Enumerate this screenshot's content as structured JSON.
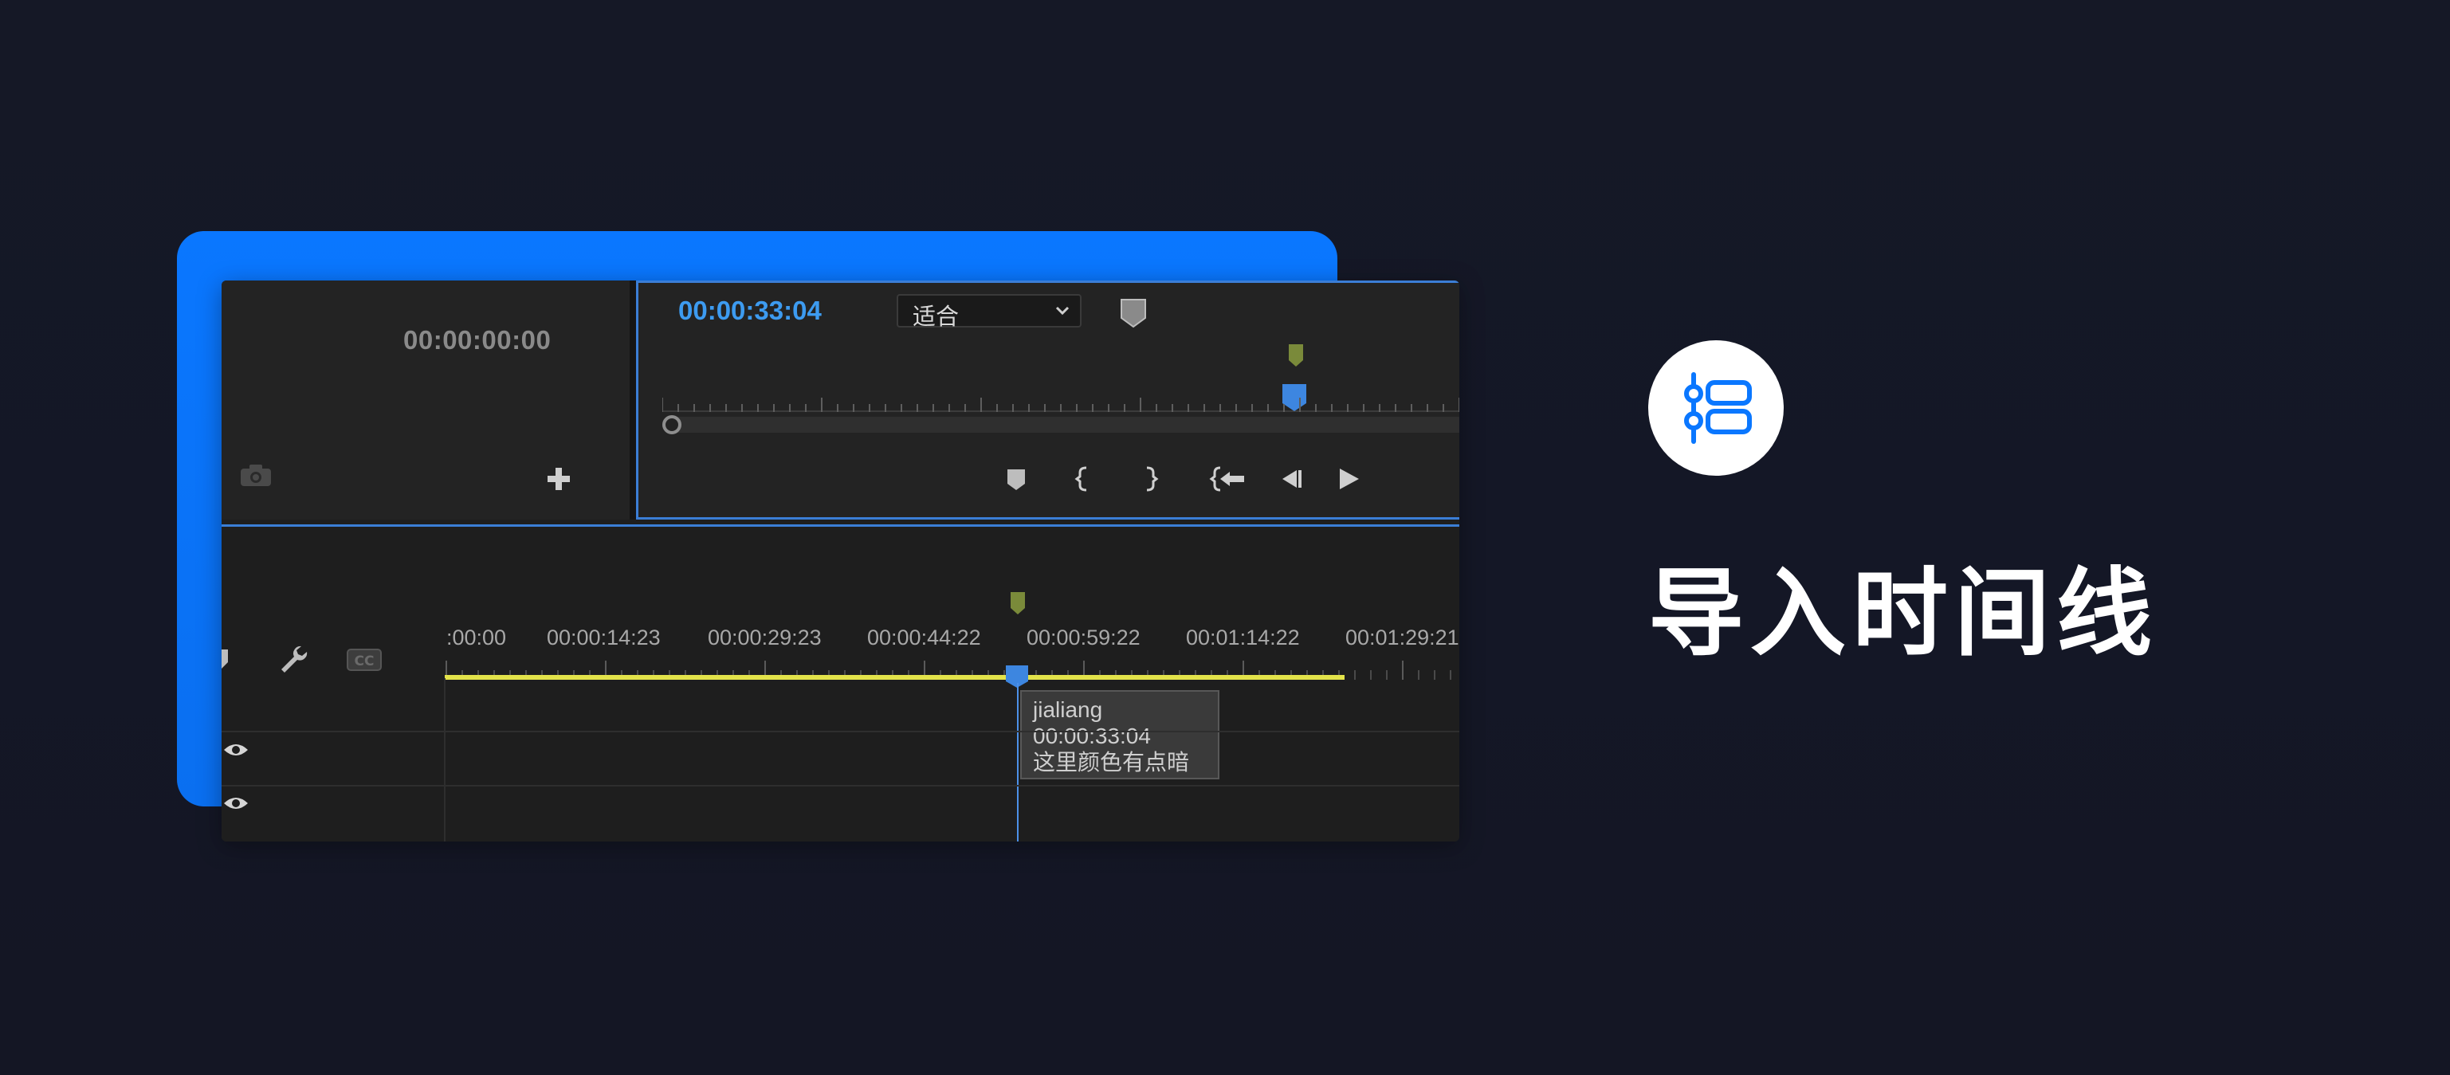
{
  "source_monitor": {
    "timecode": "00:00:00:00"
  },
  "program_monitor": {
    "timecode": "00:00:33:04",
    "zoom_select": "适合"
  },
  "timeline": {
    "ruler_labels": [
      ":00:00",
      "00:00:14:23",
      "00:00:29:23",
      "00:00:44:22",
      "00:00:59:22",
      "00:01:14:22",
      "00:01:29:21"
    ]
  },
  "tooltip": {
    "name": "jialiang",
    "timecode": "00:00:33:04",
    "comment": "这里颜色有点暗"
  },
  "feature": {
    "title": "导入时间线"
  },
  "colors": {
    "accent_blue": "#0a77ff",
    "playhead_blue": "#3d9bf0",
    "marker_green": "#7a8a3a",
    "work_area_yellow": "#e3e34a"
  },
  "icons": [
    "camera-icon",
    "add-icon",
    "chevron-down-icon",
    "marker-icon",
    "mark-in-icon",
    "mark-out-icon",
    "go-to-in-icon",
    "step-back-icon",
    "play-icon",
    "wrench-icon",
    "captions-icon",
    "eye-icon",
    "timeline-icon"
  ]
}
